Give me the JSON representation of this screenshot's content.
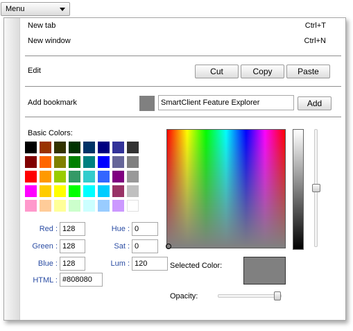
{
  "menu_button": {
    "label": "Menu"
  },
  "menu": {
    "items": [
      {
        "label": "New tab",
        "shortcut": "Ctrl+T"
      },
      {
        "label": "New window",
        "shortcut": "Ctrl+N"
      }
    ],
    "edit": {
      "label": "Edit",
      "cut": "Cut",
      "copy": "Copy",
      "paste": "Paste"
    },
    "bookmark": {
      "label": "Add bookmark",
      "icon_color": "#808080",
      "value": "SmartClient Feature Explorer",
      "add": "Add"
    }
  },
  "color_picker": {
    "basic_colors_label": "Basic Colors:",
    "basic_colors": [
      [
        "#000000",
        "#993300",
        "#333300",
        "#003300",
        "#003366",
        "#000080",
        "#333399",
        "#333333"
      ],
      [
        "#800000",
        "#FF6600",
        "#808000",
        "#008000",
        "#008080",
        "#0000FF",
        "#666699",
        "#808080"
      ],
      [
        "#FF0000",
        "#FF9900",
        "#99CC00",
        "#339966",
        "#33CCCC",
        "#3366FF",
        "#800080",
        "#999999"
      ],
      [
        "#FF00FF",
        "#FFCC00",
        "#FFFF00",
        "#00FF00",
        "#00FFFF",
        "#00CCFF",
        "#993366",
        "#C0C0C0"
      ],
      [
        "#FF99CC",
        "#FFCC99",
        "#FFFF99",
        "#CCFFCC",
        "#CCFFFF",
        "#99CCFF",
        "#CC99FF",
        "#FFFFFF"
      ]
    ],
    "red_label": "Red :",
    "red": "128",
    "green_label": "Green :",
    "green": "128",
    "blue_label": "Blue :",
    "blue": "128",
    "html_label": "HTML :",
    "html": "#808080",
    "hue_label": "Hue :",
    "hue": "0",
    "sat_label": "Sat :",
    "sat": "0",
    "lum_label": "Lum :",
    "lum": "120",
    "selected_label": "Selected Color:",
    "selected_color": "#808080",
    "opacity_label": "Opacity:",
    "opacity_percent": 100,
    "luminosity_percent": 50
  }
}
